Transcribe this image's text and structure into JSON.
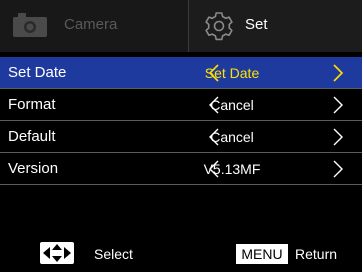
{
  "tabs": {
    "camera": {
      "label": "Camera",
      "icon": "camera-icon",
      "active": false
    },
    "set": {
      "label": "Set",
      "icon": "gear-icon",
      "active": true
    }
  },
  "menu": {
    "items": [
      {
        "label": "Set Date",
        "value": "Set Date",
        "selected": true
      },
      {
        "label": "Format",
        "value": "Cancel",
        "selected": false
      },
      {
        "label": "Default",
        "value": "Cancel",
        "selected": false
      },
      {
        "label": "Version",
        "value": "V5.13MF",
        "selected": false
      }
    ]
  },
  "footer": {
    "select_label": "Select",
    "menu_badge": "MENU",
    "return_label": "Return"
  },
  "colors": {
    "highlight_bg": "#1e3a9e",
    "selected_value": "#ffe000",
    "background": "#000000"
  }
}
